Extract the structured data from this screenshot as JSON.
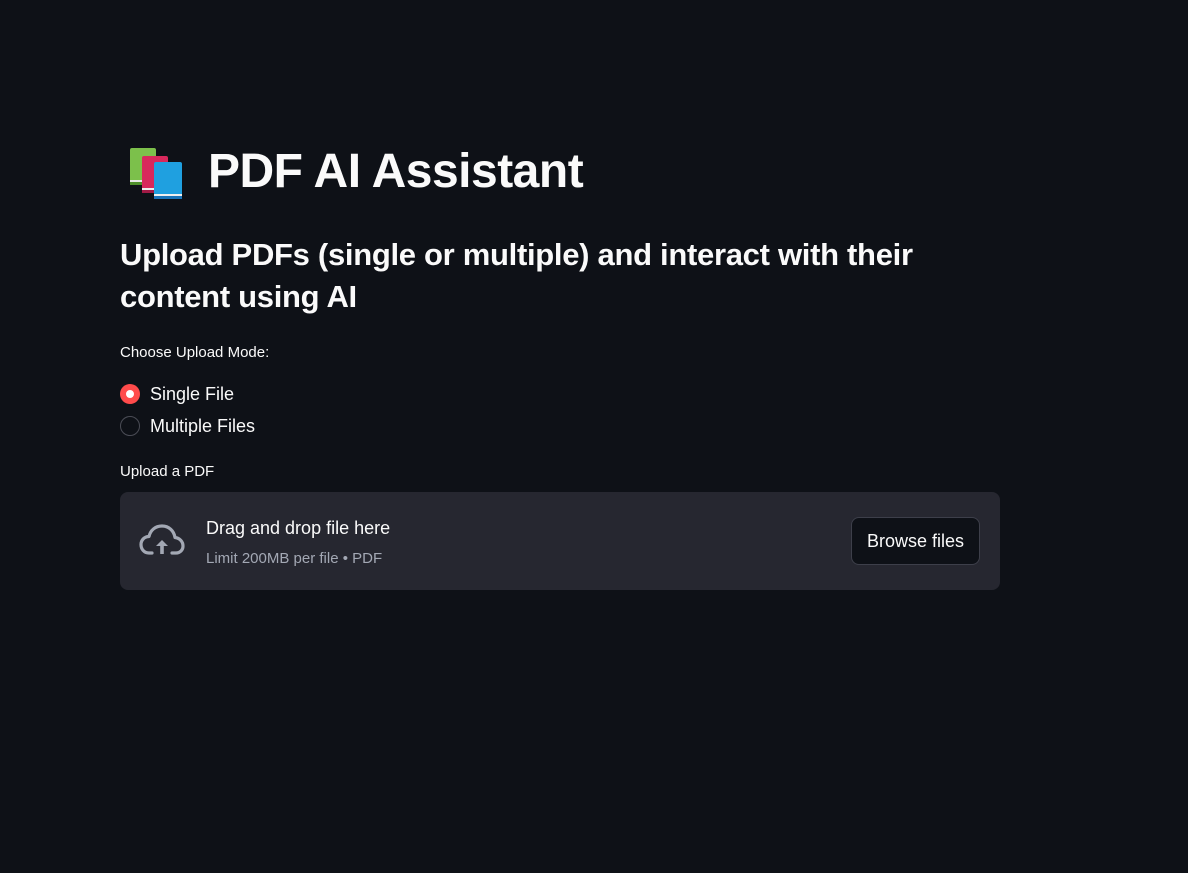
{
  "header": {
    "title": "PDF AI Assistant",
    "title_icon": "books-icon"
  },
  "subtitle": "Upload PDFs (single or multiple) and interact with their content using AI",
  "upload_mode": {
    "label": "Choose Upload Mode:",
    "options": [
      {
        "label": "Single File",
        "selected": true
      },
      {
        "label": "Multiple Files",
        "selected": false
      }
    ]
  },
  "uploader": {
    "label": "Upload a PDF",
    "drop_text": "Drag and drop file here",
    "limit_text": "Limit 200MB per file • PDF",
    "browse_label": "Browse files",
    "icon": "cloud-upload-icon"
  },
  "colors": {
    "background": "#0e1117",
    "accent": "#ff4b4b",
    "dropzone": "#262730",
    "text": "#fafafa",
    "muted_text": "#a3a8b4"
  }
}
